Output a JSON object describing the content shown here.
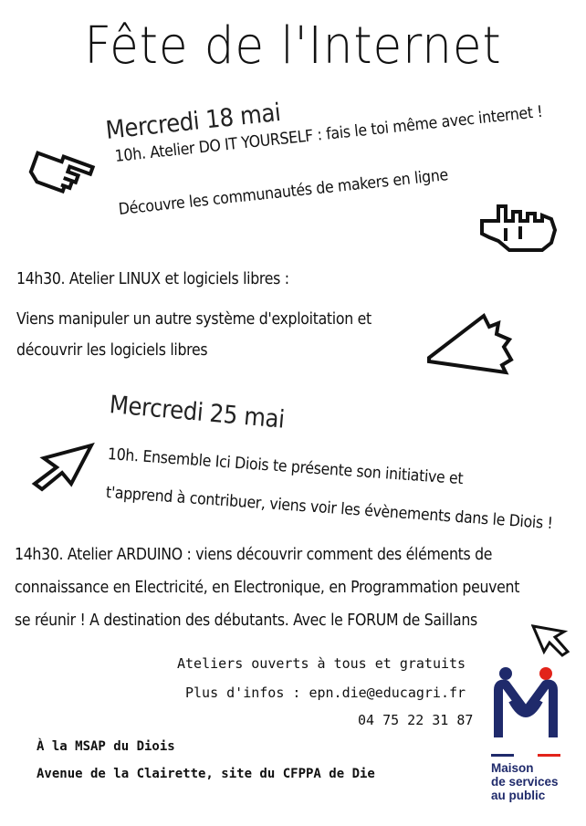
{
  "title": "Fête de l'Internet",
  "event1": {
    "date": "Mercredi 18 mai",
    "line1": "10h. Atelier DO IT YOURSELF : fais le toi même avec internet !",
    "line2": "Découvre les communautés de makers en ligne"
  },
  "event1b": {
    "line1": "14h30. Atelier LINUX et logiciels libres :",
    "line2": "Viens manipuler un autre système d'exploitation et",
    "line3": "découvrir les logiciels libres"
  },
  "event2": {
    "date": "Mercredi 25 mai",
    "line1": "10h. Ensemble Ici Diois te présente son initiative et",
    "line2": "t'apprend à contribuer, viens voir les évènements dans le Diois !"
  },
  "event2b": {
    "line1": "14h30. Atelier ARDUINO : viens découvrir comment des éléments de",
    "line2": "connaissance en Electricité, en Electronique, en Programmation peuvent",
    "line3": "se réunir !  A destination des débutants. Avec le FORUM de Saillans"
  },
  "info": {
    "open": "Ateliers ouverts à tous et gratuits",
    "more": "Plus d'infos : epn.die@educagri.fr",
    "phone": "04 75 22 31 87"
  },
  "venue": {
    "line1": "À la MSAP du Diois",
    "line2": "Avenue de la Clairette, site du CFPPA de Die"
  },
  "logo": {
    "line1": "Maison",
    "line2": "de services",
    "line3": "au public"
  },
  "colors": {
    "logo_blue": "#1f2a6b",
    "logo_red": "#e2231a"
  },
  "icons": [
    "pointing-hand-icon",
    "pointing-hand-icon",
    "cursor-arrow-icon",
    "cursor-arrow-icon",
    "cursor-arrow-icon",
    "msap-logo-icon"
  ]
}
